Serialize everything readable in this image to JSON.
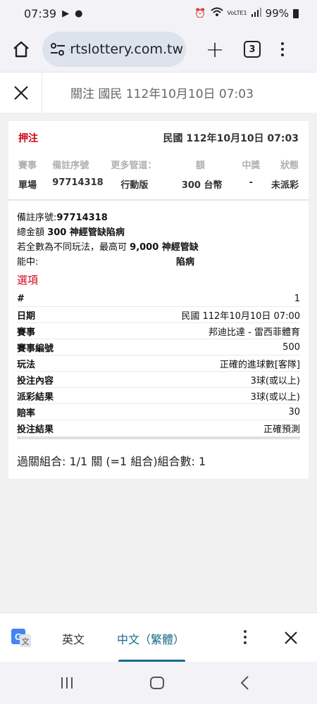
{
  "status": {
    "time": "07:39",
    "battery": "99%",
    "signal_label": "VoLTE1"
  },
  "browser": {
    "url": "sportslottery.com.tw",
    "tab_count": "3"
  },
  "header": {
    "title": "關注 國民 112年10月10日 07:03"
  },
  "card": {
    "bet_title": "押注",
    "bet_date": "民國 112年10月10日 07:03",
    "summary_headers": [
      "賽事",
      "備註序號",
      "更多管道：",
      "額",
      "中獎",
      "狀態"
    ],
    "summary_values": [
      "單場",
      "97714318",
      "行動版",
      "300 台幣",
      "-",
      "未派彩"
    ],
    "detail": {
      "serial_label": "備註序號:",
      "serial_value": "97714318",
      "total_label": "總金額",
      "total_value": "300 神經管缺陷病",
      "max_text": "若全數為不同玩法，最高可",
      "max_value": "9,000 神經管缺",
      "win_label": "能中:",
      "win_value": "陷病"
    },
    "options_title": "選項",
    "rows": [
      {
        "k": "#",
        "v": "1"
      },
      {
        "k": "日期",
        "v": "民國 112年10月10日 07:00"
      },
      {
        "k": "賽事",
        "v": "邦迪比達 - 雷西菲體育"
      },
      {
        "k": "賽事編號",
        "v": "500"
      },
      {
        "k": "玩法",
        "v": "正確的進球數[客隊]"
      },
      {
        "k": "投注內容",
        "v": "3球(或以上)"
      },
      {
        "k": "派彩結果",
        "v": "3球(或以上)"
      },
      {
        "k": "賠率",
        "v": "30"
      },
      {
        "k": "投注結果",
        "v": "正確預測"
      }
    ],
    "combo": "過關組合: 1/1 關 (=1 組合)組合數: 1"
  },
  "translate": {
    "lang_source": "英文",
    "lang_target": "中文（繁體）"
  }
}
